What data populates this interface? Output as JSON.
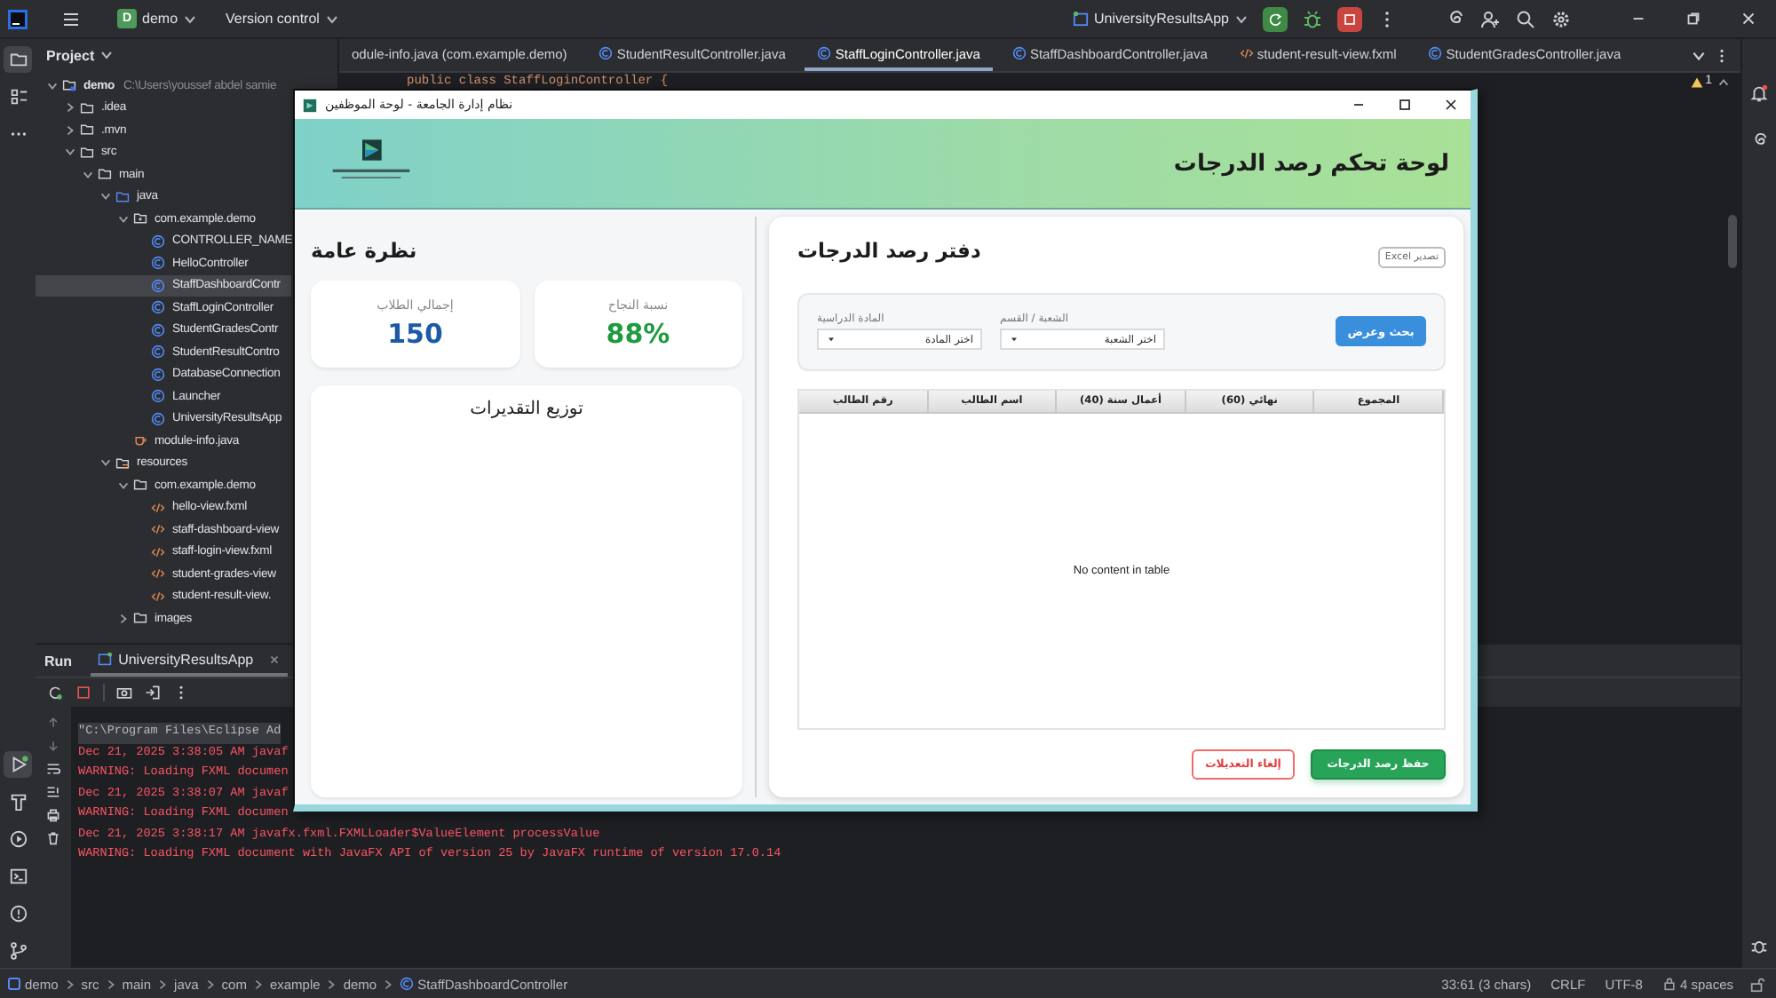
{
  "ide": {
    "top_bar": {
      "project_badge": "D",
      "project": "demo",
      "vcs": "Version control",
      "run_config": "UniversityResultsApp"
    },
    "left_stripe_top": [
      {
        "kind": "project",
        "selected": true
      },
      {
        "kind": "structure",
        "selected": false
      },
      {
        "kind": "more",
        "selected": false
      }
    ],
    "left_stripe_bottom": [
      {
        "kind": "run",
        "selected": true
      },
      {
        "kind": "build",
        "selected": false
      },
      {
        "kind": "services",
        "selected": false
      },
      {
        "kind": "terminal",
        "selected": false
      },
      {
        "kind": "problems",
        "selected": false
      },
      {
        "kind": "git",
        "selected": false
      }
    ],
    "project_panel": {
      "title": "Project",
      "tree": [
        {
          "name": "demo",
          "path": "C:\\Users\\youssef abdel samie",
          "kind": "module",
          "expanded": true,
          "selected": false,
          "children": [
            {
              "name": ".idea",
              "kind": "folder",
              "expanded": false,
              "selected": false
            },
            {
              "name": ".mvn",
              "kind": "folder",
              "expanded": false,
              "selected": false
            },
            {
              "name": "src",
              "kind": "folder",
              "expanded": true,
              "selected": false,
              "children": [
                {
                  "name": "main",
                  "kind": "folder",
                  "expanded": true,
                  "selected": false,
                  "children": [
                    {
                      "name": "java",
                      "kind": "source-folder",
                      "expanded": true,
                      "selected": false,
                      "children": [
                        {
                          "name": "com.example.demo",
                          "kind": "package",
                          "expanded": true,
                          "selected": false,
                          "children": [
                            {
                              "name": "CONTROLLER_NAME",
                              "kind": "class",
                              "selected": false
                            },
                            {
                              "name": "HelloController",
                              "kind": "class",
                              "selected": false
                            },
                            {
                              "name": "StaffDashboardContr",
                              "kind": "class",
                              "selected": true
                            },
                            {
                              "name": "StaffLoginController",
                              "kind": "class",
                              "selected": false
                            },
                            {
                              "name": "StudentGradesContr",
                              "kind": "class",
                              "selected": false
                            },
                            {
                              "name": "StudentResultContro",
                              "kind": "class",
                              "selected": false
                            },
                            {
                              "name": "DatabaseConnection",
                              "kind": "class",
                              "selected": false
                            },
                            {
                              "name": "Launcher",
                              "kind": "class",
                              "selected": false
                            },
                            {
                              "name": "UniversityResultsApp",
                              "kind": "class",
                              "selected": false
                            }
                          ]
                        },
                        {
                          "name": "module-info.java",
                          "kind": "java-file",
                          "selected": false
                        }
                      ]
                    },
                    {
                      "name": "resources",
                      "kind": "resources-folder",
                      "expanded": true,
                      "selected": false,
                      "children": [
                        {
                          "name": "com.example.demo",
                          "kind": "folder",
                          "expanded": true,
                          "selected": false,
                          "children": [
                            {
                              "name": "hello-view.fxml",
                              "kind": "fxml",
                              "selected": false
                            },
                            {
                              "name": "staff-dashboard-view",
                              "kind": "fxml",
                              "selected": false
                            },
                            {
                              "name": "staff-login-view.fxml",
                              "kind": "fxml",
                              "selected": false
                            },
                            {
                              "name": "student-grades-view",
                              "kind": "fxml",
                              "selected": false
                            },
                            {
                              "name": "student-result-view.",
                              "kind": "fxml",
                              "selected": false
                            }
                          ]
                        },
                        {
                          "name": "images",
                          "kind": "folder",
                          "expanded": false,
                          "selected": false
                        }
                      ]
                    }
                  ]
                }
              ]
            }
          ]
        }
      ]
    },
    "editor": {
      "tabs": [
        {
          "label": "odule-info.java (com.example.demo)",
          "selected": false
        },
        {
          "label": "StudentResultController.java",
          "kind": "class",
          "selected": false
        },
        {
          "label": "StaffLoginController.java",
          "kind": "class",
          "selected": true
        },
        {
          "label": "StaffDashboardController.java",
          "kind": "class",
          "selected": false
        },
        {
          "label": "student-result-view.fxml",
          "kind": "fxml",
          "selected": false
        },
        {
          "label": "StudentGradesController.java",
          "kind": "class",
          "selected": false
        }
      ],
      "code_line": "public class StaffLoginController {",
      "warning_count": "1"
    },
    "run_panel": {
      "title": "Run",
      "tab": {
        "label": "UniversityResultsApp",
        "selected": true
      },
      "console": [
        {
          "kind": "command",
          "text": "\"C:\\Program Files\\Eclipse Ad"
        },
        {
          "kind": "error",
          "text": "Dec 21, 2025 3:38:05 AM javaf"
        },
        {
          "kind": "error",
          "text": "WARNING: Loading FXML documen"
        },
        {
          "kind": "error",
          "text": "Dec 21, 2025 3:38:07 AM javaf"
        },
        {
          "kind": "error",
          "text": "WARNING: Loading FXML documen"
        },
        {
          "kind": "error",
          "text": "Dec 21, 2025 3:38:17 AM javafx.fxml.FXMLLoader$ValueElement processValue"
        },
        {
          "kind": "error",
          "text": "WARNING: Loading FXML document with JavaFX API of version 25 by JavaFX runtime of version 17.0.14"
        }
      ]
    },
    "status_bar": {
      "breadcrumbs": [
        "demo",
        "src",
        "main",
        "java",
        "com",
        "example",
        "demo",
        "StaffDashboardController"
      ],
      "position": "33:61 (3 chars)",
      "line_ending": "CRLF",
      "encoding": "UTF-8",
      "indent": "4 spaces"
    }
  },
  "app_window": {
    "title": "نظام إدارة الجامعة - لوحة الموظفين",
    "header_title": "لوحة تحكم رصد الدرجات",
    "overview": {
      "title": "نظرة عامة",
      "pass_rate": {
        "label": "نسبة النجاح",
        "value": "88%"
      },
      "total_students": {
        "label": "إجمالي الطلاب",
        "value": "150"
      },
      "chart_title": "توزيع التقديرات"
    },
    "gradebook": {
      "title": "دفتر رصد الدرجات",
      "export_button": "تصدير Excel",
      "filters": [
        {
          "label": "الشعبة / القسم",
          "placeholder": "اختر الشعبة"
        },
        {
          "label": "المادة الدراسية",
          "placeholder": "اختر المادة"
        }
      ],
      "search_button": "بحث وعرض",
      "table": {
        "columns": [
          "المجموع",
          "نهائي (60)",
          "أعمال سنة (40)",
          "اسم الطالب",
          "رقم الطالب"
        ],
        "empty_text": "No content in table"
      },
      "buttons": [
        {
          "kind": "primary",
          "label": "حفظ رصد الدرجات"
        },
        {
          "kind": "secondary",
          "label": "إلغاء التعديلات"
        }
      ]
    }
  }
}
